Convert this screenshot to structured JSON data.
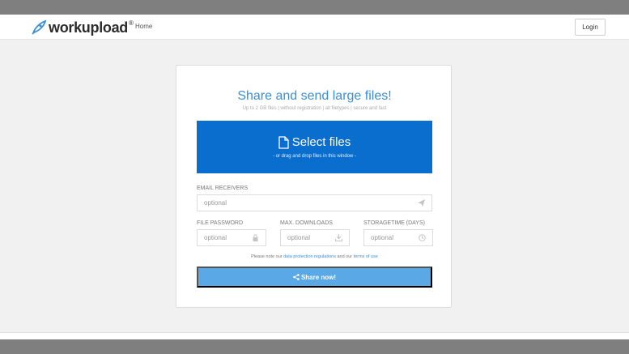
{
  "header": {
    "logo_text": "workupload",
    "logo_reg": "®",
    "nav_home": "Home",
    "login_label": "Login"
  },
  "card": {
    "title": "Share and send large files!",
    "subtitle": "Up to 2 GB files | without registration | all filetypes | secure and fast",
    "select": {
      "label": "Select files",
      "sub": "- or drag and drop files in this window -"
    },
    "email": {
      "label": "EMAIL RECEIVERS",
      "placeholder": "optional"
    },
    "password": {
      "label": "FILE PASSWORD",
      "placeholder": "optional"
    },
    "downloads": {
      "label": "MAX. DOWNLOADS",
      "placeholder": "optional"
    },
    "storage": {
      "label": "STORAGETIME (DAYS)",
      "placeholder": "optional"
    },
    "notice": {
      "prefix": "Please note our ",
      "link1": "data protection regulations",
      "middle": " and our ",
      "link2": "terms of use"
    },
    "share_label": "Share now!"
  },
  "colors": {
    "brand_blue": "#3a8fd8",
    "select_blue": "#0a6ecf",
    "share_blue": "#5aa8e6"
  }
}
